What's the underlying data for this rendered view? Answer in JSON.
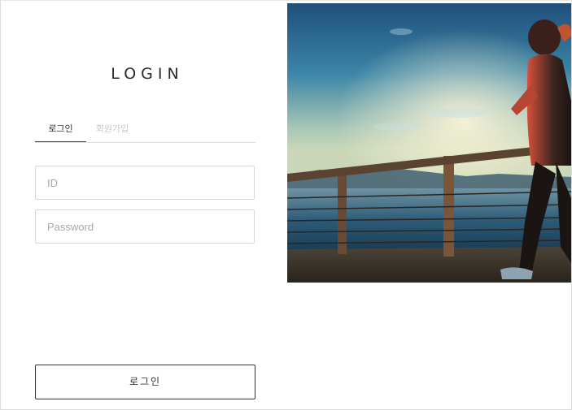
{
  "login_panel": {
    "title": "LOGIN",
    "tabs": [
      {
        "label": "로그인",
        "active": true
      },
      {
        "label": "회원가입",
        "active": false
      }
    ],
    "id_field": {
      "placeholder": "ID",
      "value": ""
    },
    "password_field": {
      "placeholder": "Password",
      "value": ""
    },
    "submit_label": "로그인"
  },
  "hero_image": {
    "description_icon": "runner-photo"
  },
  "colors": {
    "text_dark": "#2c2c2c",
    "border": "#d6d6d6",
    "tab_inactive": "#c9c9c9",
    "button_border": "#333333"
  }
}
